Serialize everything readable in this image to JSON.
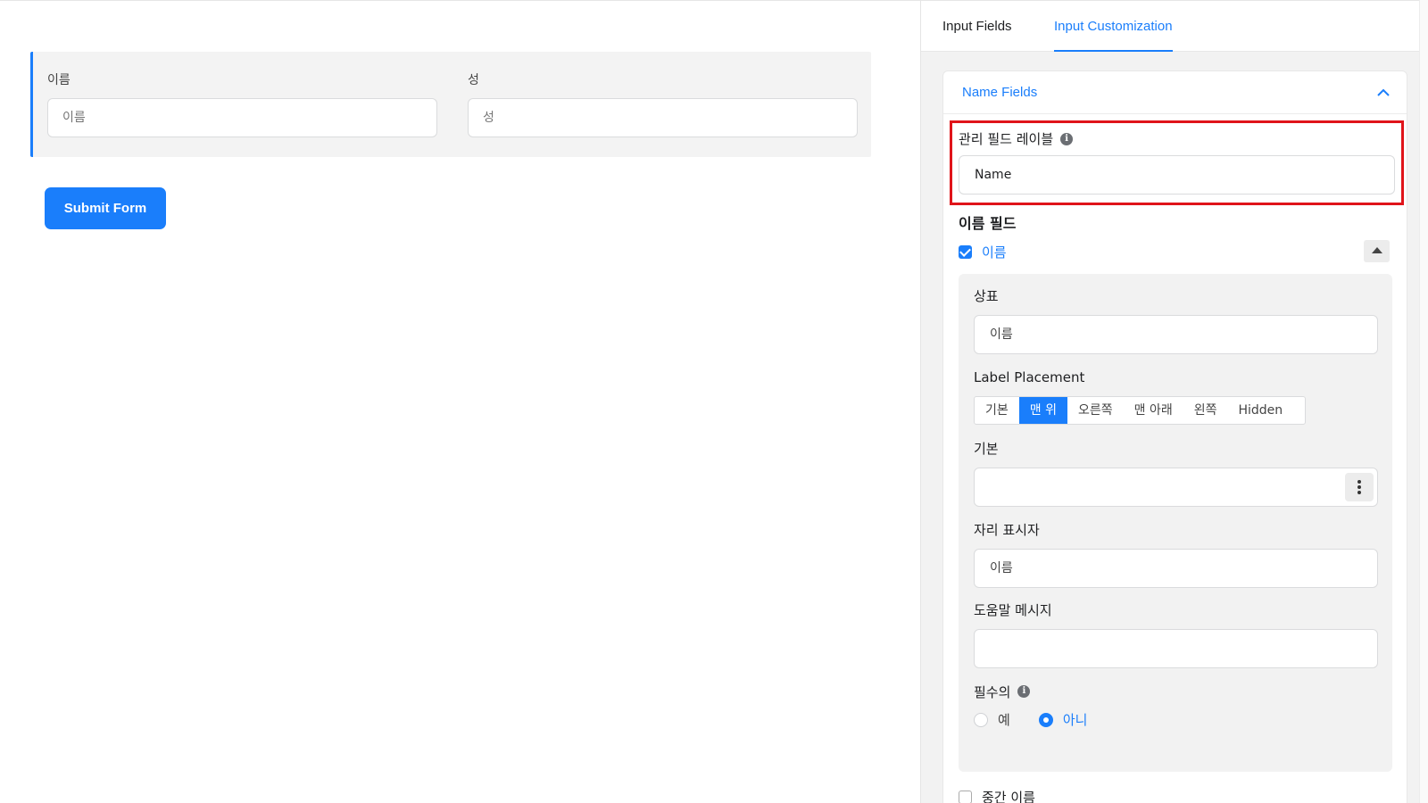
{
  "form": {
    "first_label": "이름",
    "first_placeholder": "이름",
    "last_label": "성",
    "last_placeholder": "성",
    "submit_label": "Submit Form",
    "accent_color": "#1a7efb"
  },
  "panel": {
    "tabs": [
      {
        "label": "Input Fields",
        "active": false
      },
      {
        "label": "Input Customization",
        "active": true
      }
    ],
    "section_title": "Name Fields",
    "admin_label": {
      "label": "관리 필드 레이블",
      "value": "Name",
      "highlight_color": "#e0141a"
    },
    "subfield_title": "이름 필드",
    "first_name": {
      "checkbox_label": "이름",
      "checked": true,
      "label_field": {
        "label": "상표",
        "value": "이름"
      },
      "label_placement": {
        "label": "Label Placement",
        "options": [
          "기본",
          "맨 위",
          "오른쪽",
          "맨 아래",
          "왼쪽",
          "Hidden"
        ],
        "selected": "맨 위"
      },
      "default_field": {
        "label": "기본",
        "value": ""
      },
      "placeholder_field": {
        "label": "자리 표시자",
        "value": "이름"
      },
      "help_field": {
        "label": "도움말 메시지",
        "value": ""
      },
      "required": {
        "label": "필수의",
        "options": [
          "예",
          "아니"
        ],
        "selected": "아니"
      }
    },
    "next_item": "중간 이름"
  },
  "icons": {
    "info": "info-icon",
    "collapse": "chevron-up-icon",
    "toggle": "triangle-up-icon",
    "more": "kebab-menu-icon"
  }
}
